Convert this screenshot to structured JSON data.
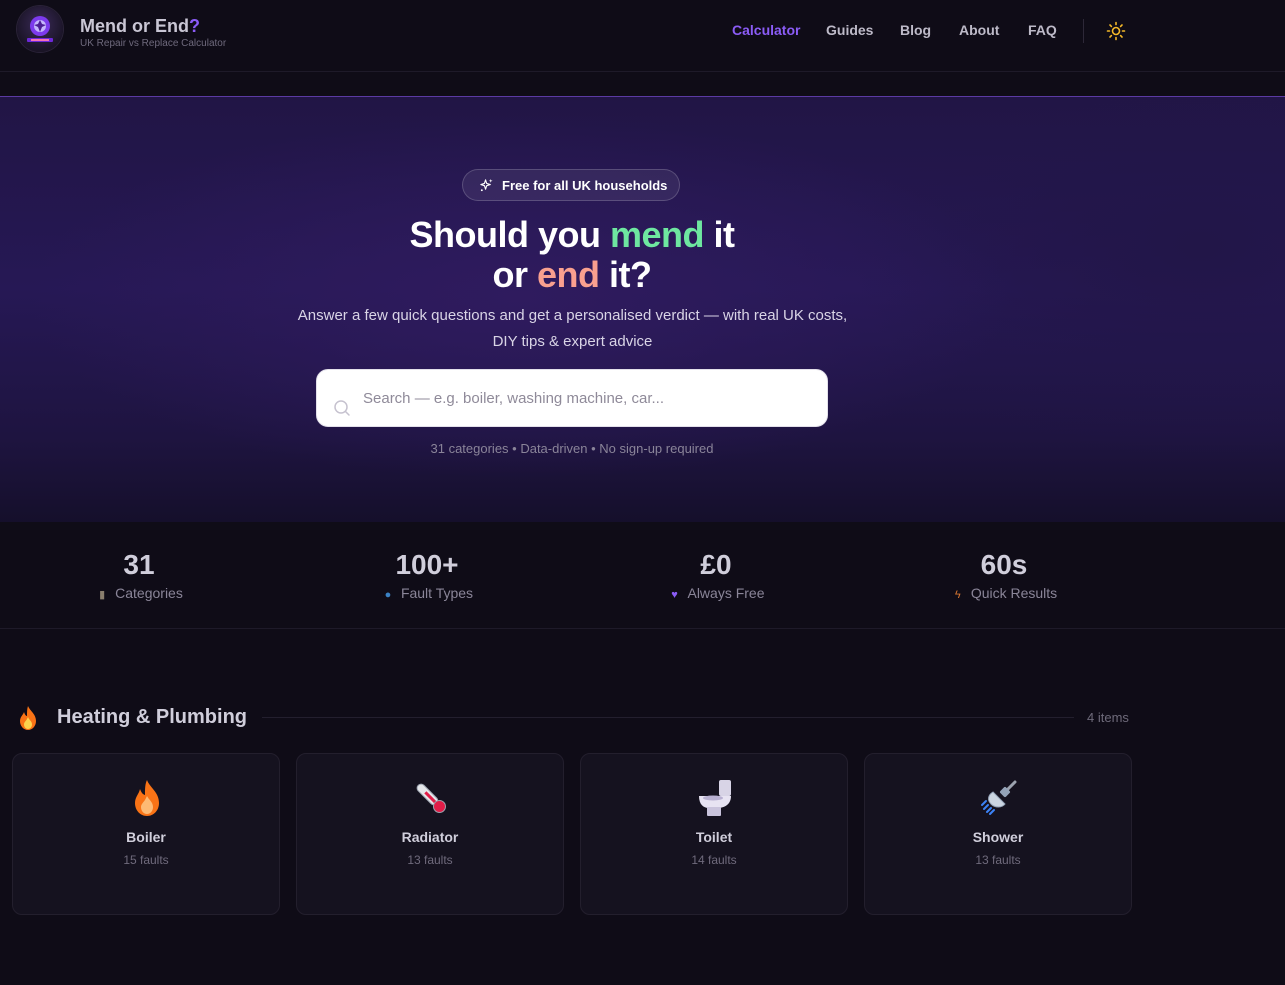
{
  "brand": {
    "title": "Mend or End",
    "title_q": "?",
    "subtitle": "UK Repair vs Replace Calculator"
  },
  "nav": {
    "items": [
      {
        "label": "Calculator",
        "active": true
      },
      {
        "label": "Guides",
        "active": false
      },
      {
        "label": "Blog",
        "active": false
      },
      {
        "label": "About",
        "active": false
      },
      {
        "label": "FAQ",
        "active": false
      }
    ],
    "theme_icon": "sun-icon"
  },
  "hero": {
    "pill": "Free for all UK households",
    "headline": {
      "part1": "Should you ",
      "mend": "mend",
      "part2": " it",
      "part3": "or ",
      "end": "end",
      "part4": " it?"
    },
    "subtext": "Answer a few quick questions and get a personalised verdict — with real UK costs, DIY tips & expert advice",
    "search": {
      "placeholder": "Search — e.g. boiler, washing machine, car...",
      "value": ""
    },
    "meta": "31 categories • Data-driven • No sign-up required"
  },
  "stats": [
    {
      "value": "31",
      "label": "Categories",
      "icon": "clipboard-icon"
    },
    {
      "value": "100+",
      "label": "Fault Types",
      "icon": "magnifier-icon"
    },
    {
      "value": "£0",
      "label": "Always Free",
      "icon": "purple-heart-icon"
    },
    {
      "value": "60s",
      "label": "Quick Results",
      "icon": "lightning-icon"
    }
  ],
  "section": {
    "title": "Heating & Plumbing",
    "count": "4 items",
    "icon": "fire-icon",
    "cards": [
      {
        "name": "Boiler",
        "faults": "15 faults",
        "icon": "fire-icon"
      },
      {
        "name": "Radiator",
        "faults": "13 faults",
        "icon": "thermometer-icon"
      },
      {
        "name": "Toilet",
        "faults": "14 faults",
        "icon": "toilet-icon"
      },
      {
        "name": "Shower",
        "faults": "13 faults",
        "icon": "shower-icon"
      }
    ]
  },
  "colors": {
    "accent": "#8b5cf6",
    "mend": "#6ee7a0",
    "end": "#f9a08f",
    "background": "#0f0c17"
  }
}
